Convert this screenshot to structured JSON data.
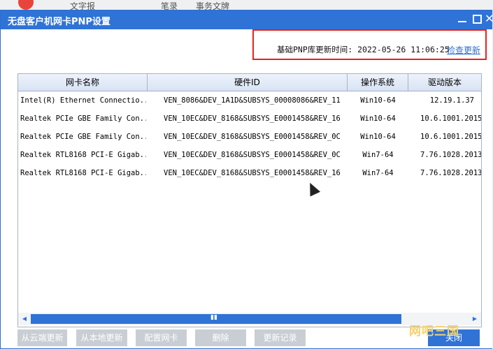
{
  "background": {
    "fragment_1": "文字报",
    "fragment_2": "笔录",
    "fragment_3": "事务文牌"
  },
  "window": {
    "title": "无盘客户机网卡PNP设置",
    "close_glyph": "✕"
  },
  "update_info": {
    "label": "基础PNP库更新时间: 2022-05-26 11:06:25",
    "check_link": "检查更新"
  },
  "table": {
    "columns": [
      "网卡名称",
      "硬件ID",
      "操作系统",
      "驱动版本"
    ],
    "rows": [
      [
        "Intel(R) Ethernet Connectio...",
        "VEN_8086&DEV_1A1D&SUBSYS_00008086&REV_11",
        "Win10-64",
        "12.19.1.37"
      ],
      [
        "Realtek PCIe GBE Family Con...",
        "VEN_10EC&DEV_8168&SUBSYS_E0001458&REV_16",
        "Win10-64",
        "10.6.1001.2015"
      ],
      [
        "Realtek PCIe GBE Family Con...",
        "VEN_10EC&DEV_8168&SUBSYS_E0001458&REV_0C",
        "Win10-64",
        "10.6.1001.2015"
      ],
      [
        "Realtek RTL8168 PCI-E Gigab...",
        "VEN_10EC&DEV_8168&SUBSYS_E0001458&REV_0C",
        "Win7-64",
        "7.76.1028.2013"
      ],
      [
        "Realtek RTL8168 PCI-E Gigab...",
        "VEN_10EC&DEV_8168&SUBSYS_E0001458&REV_16",
        "Win7-64",
        "7.76.1028.2013"
      ]
    ]
  },
  "scrollbar": {
    "left_arrow": "◀",
    "right_arrow": "▶",
    "grip": "▮▮"
  },
  "buttons": {
    "cloud_update": "从云端更新",
    "local_update": "从本地更新",
    "config_nic": "配置网卡",
    "delete": "删除",
    "update_log": "更新记录",
    "close": "关闭"
  },
  "watermark": "网吧三国",
  "colors": {
    "titlebar": "#2f73d6",
    "highlight_border": "#e8211e",
    "link": "#2f6fd0",
    "disabled_button": "#c9ced4"
  }
}
